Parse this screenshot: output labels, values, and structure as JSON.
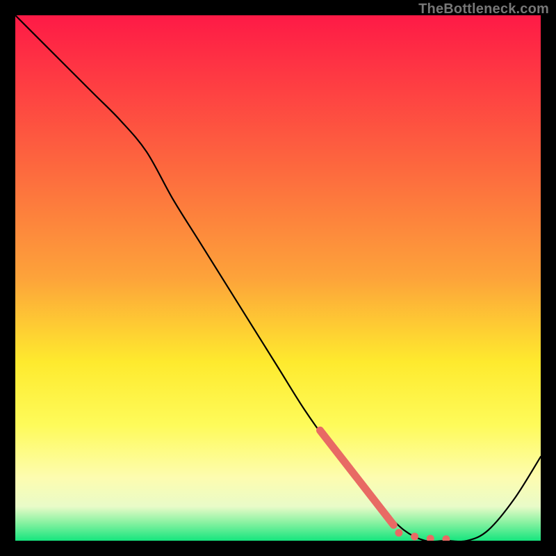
{
  "watermark": "TheBottleneck.com",
  "colors": {
    "frame": "#000000",
    "curve": "#000000",
    "marker": "#e86a64",
    "gradient_top": "#fe1a46",
    "gradient_mid_upper": "#fda33a",
    "gradient_mid": "#feea2e",
    "gradient_lower": "#fdfcb0",
    "gradient_band": "#e9fbc8",
    "gradient_bottom": "#16e57e"
  },
  "chart_data": {
    "type": "line",
    "title": "",
    "xlabel": "",
    "ylabel": "",
    "xlim": [
      0,
      100
    ],
    "ylim": [
      0,
      100
    ],
    "series": [
      {
        "name": "bottleneck-curve",
        "x": [
          0,
          5,
          10,
          15,
          20,
          25,
          30,
          35,
          40,
          45,
          50,
          55,
          60,
          65,
          70,
          74,
          78,
          82,
          86,
          90,
          95,
          100
        ],
        "y": [
          100,
          95,
          90,
          85,
          80,
          74,
          65,
          57,
          49,
          41,
          33,
          25,
          18,
          12,
          6,
          2,
          0,
          0,
          0,
          2,
          8,
          16
        ]
      }
    ],
    "highlight_segment": {
      "name": "thick-segment",
      "x": [
        58,
        72
      ],
      "y": [
        21,
        3
      ]
    },
    "markers": {
      "name": "dots",
      "points": [
        {
          "x": 73,
          "y": 1.5
        },
        {
          "x": 76,
          "y": 0.8
        },
        {
          "x": 79,
          "y": 0.4
        },
        {
          "x": 82,
          "y": 0.3
        }
      ]
    }
  }
}
